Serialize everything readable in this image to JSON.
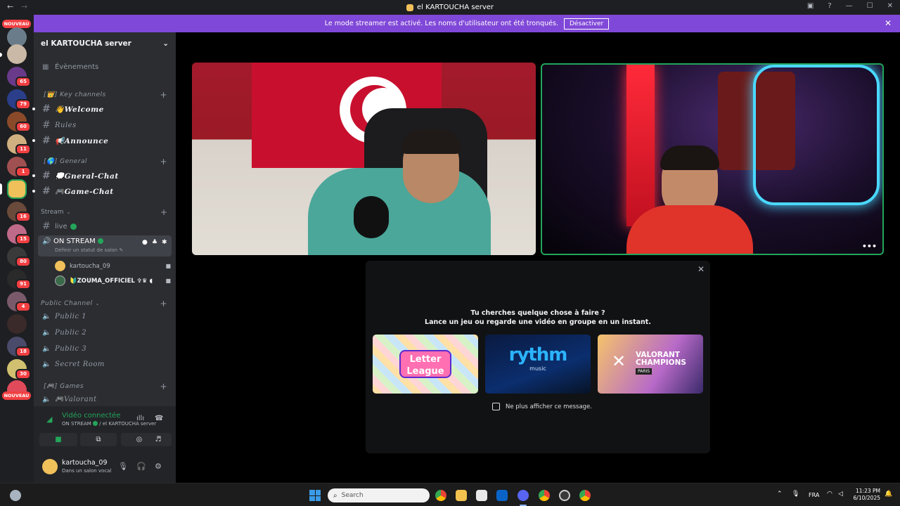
{
  "window": {
    "title": "el KARTOUCHA server",
    "back_icon": "←",
    "forward_icon": "→",
    "buttons": [
      "▣",
      "?",
      "—",
      "☐",
      "✕"
    ]
  },
  "guilds": {
    "nouveau_label": "NOUVEAU",
    "badges": [
      "65",
      "79",
      "60",
      "11",
      "1",
      "16",
      "15",
      "80",
      "91",
      "4",
      "18",
      "30"
    ]
  },
  "banner": {
    "text": "Le mode streamer est activé. Les noms d'utilisateur ont été tronqués.",
    "button": "Désactiver",
    "close": "✕"
  },
  "server": {
    "name": "el KARTOUCHA server",
    "chevron": "⌄"
  },
  "sidebar": {
    "events": "Évènements",
    "categories": {
      "key": "[👑] Key channels",
      "general": "[🌎] General",
      "stream": "Stream",
      "public": "Public Channel",
      "games": "[🎮] Games"
    },
    "channels": {
      "welcome": "👋Welcome",
      "rules": "Rules",
      "announce": "📢Announce",
      "gneral_chat": "💭Gneral-Chat",
      "game_chat": "🎮Game-Chat",
      "live": "live",
      "on_stream": "ON STREAM",
      "on_stream_status": "Définir un statut de salon ✎",
      "public1": "Public 1",
      "public2": "Public 2",
      "public3": "Public 3",
      "secret": "Secret Room",
      "valorant": "🎮Valorant"
    },
    "members": [
      {
        "name": "kartoucha_09"
      },
      {
        "name": "🔰ZOUMA_OFFICIEL ✞♛ ◖"
      }
    ]
  },
  "voice": {
    "title": "Vidéo connectée",
    "subtitle_channel": "ON STREAM",
    "subtitle_server": " / el KARTOUCHA server"
  },
  "user": {
    "name": "kartoucha_09",
    "status": "Dans un salon vocal"
  },
  "stream": {
    "more": "•••"
  },
  "popup": {
    "line1": "Tu cherches quelque chose à faire ?",
    "line2": "Lance un jeu ou regarde une vidéo en groupe en un instant.",
    "close": "✕",
    "cards": [
      {
        "title": "Letter League"
      },
      {
        "title": "rythm",
        "sub": "music"
      },
      {
        "title": "VALORANT CHAMPIONS",
        "sub": "PARIS"
      }
    ],
    "checkbox": "Ne plus afficher ce message."
  },
  "taskbar": {
    "search": "Search",
    "lang": "FRA",
    "time": "11:23 PM",
    "date": "6/10/2025"
  },
  "colors": {
    "accent": "#8048d8",
    "green": "#23a55a",
    "red": "#f23f42",
    "sidebar": "#2b2d31"
  }
}
